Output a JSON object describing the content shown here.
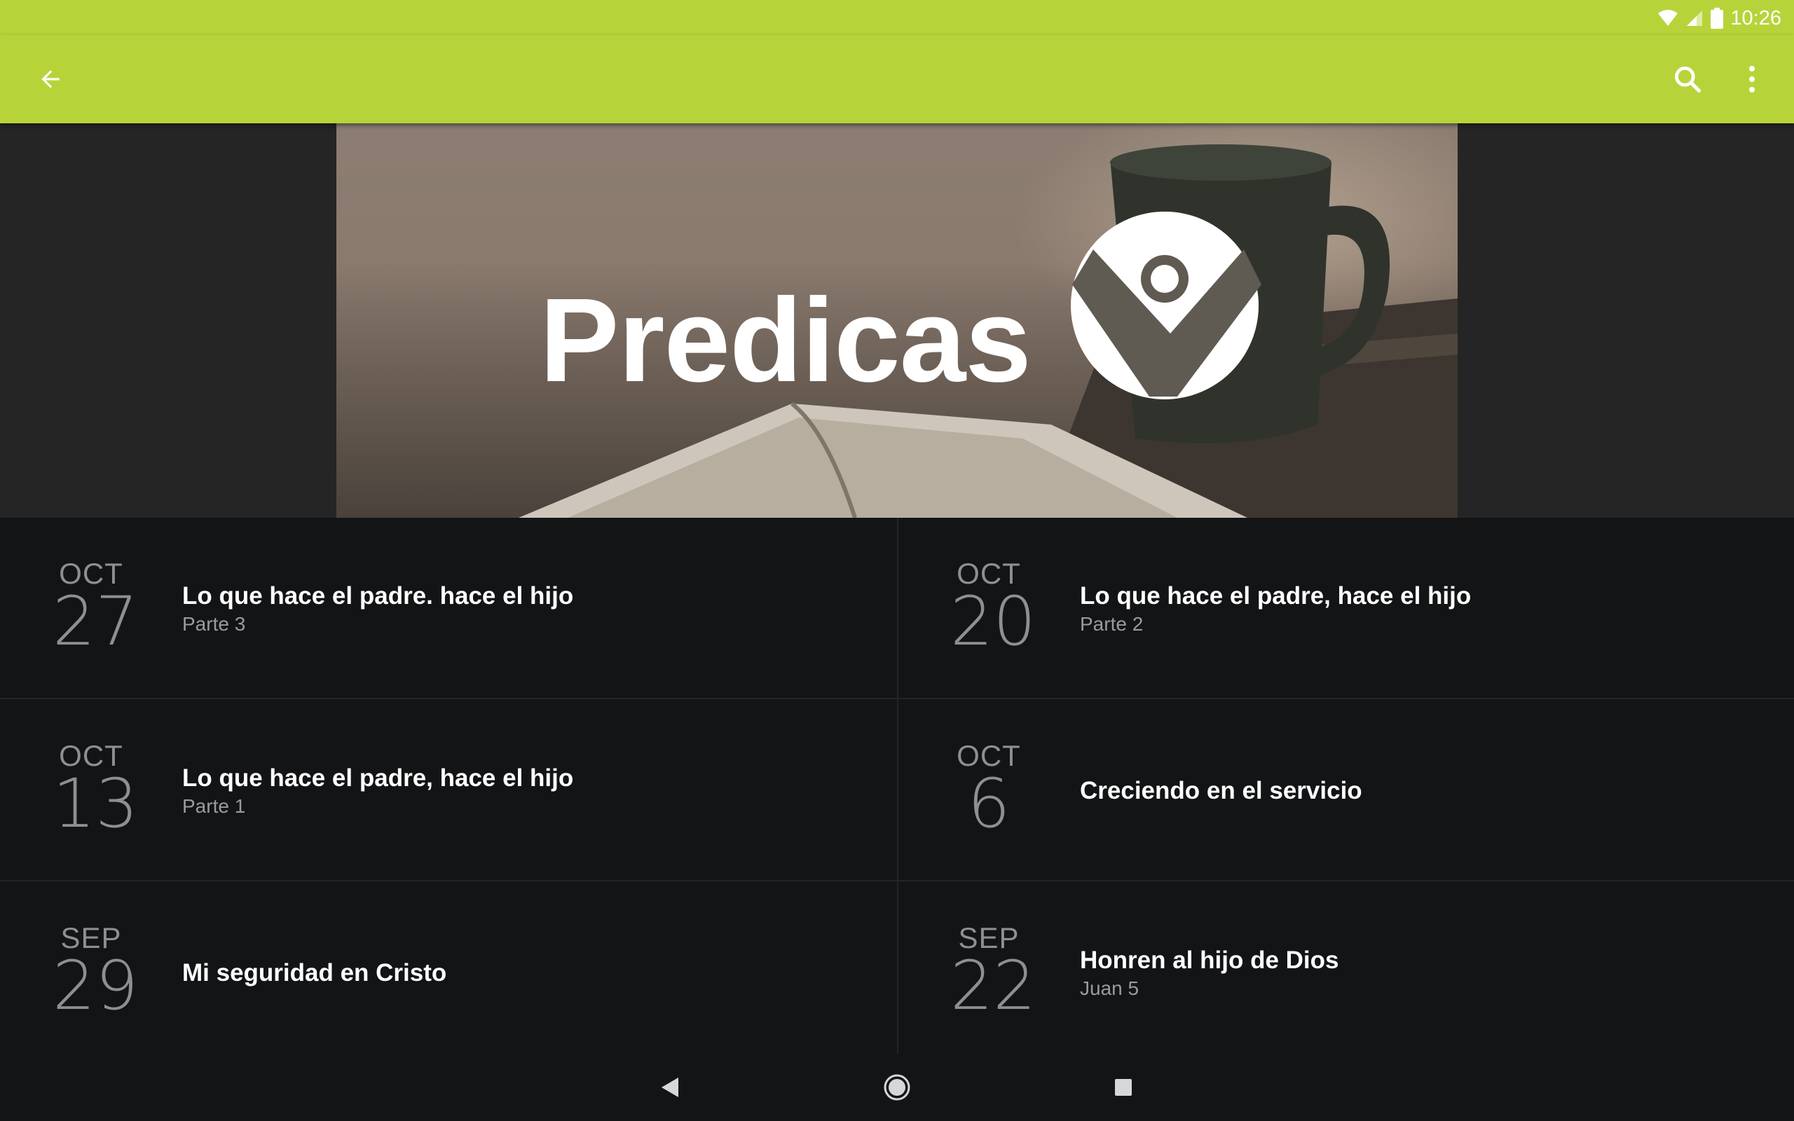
{
  "status": {
    "time": "10:26"
  },
  "appbar": {
    "color": "#b6d43a"
  },
  "hero": {
    "title": "Predicas",
    "logo_icon": "church-person-logo"
  },
  "sermons": [
    {
      "month": "OCT",
      "day": "27",
      "title": "Lo que hace el padre. hace el hijo",
      "subtitle": "Parte 3"
    },
    {
      "month": "OCT",
      "day": "20",
      "title": "Lo que hace el padre, hace el hijo",
      "subtitle": "Parte 2"
    },
    {
      "month": "OCT",
      "day": "13",
      "title": "Lo que hace el padre, hace el hijo",
      "subtitle": "Parte 1"
    },
    {
      "month": "OCT",
      "day": "6",
      "title": "Creciendo en el servicio",
      "subtitle": ""
    },
    {
      "month": "SEP",
      "day": "29",
      "title": "Mi seguridad en Cristo",
      "subtitle": ""
    },
    {
      "month": "SEP",
      "day": "22",
      "title": "Honren al hijo de Dios",
      "subtitle": "Juan 5"
    }
  ]
}
